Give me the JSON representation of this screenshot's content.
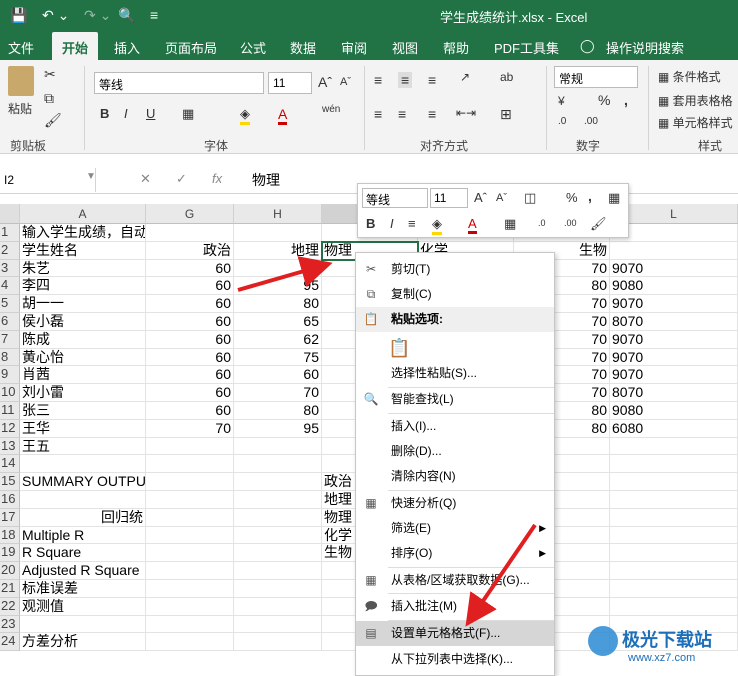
{
  "title": "学生成绩统计.xlsx - Excel",
  "tabs": [
    "文件",
    "开始",
    "插入",
    "页面布局",
    "公式",
    "数据",
    "审阅",
    "视图",
    "帮助",
    "PDF工具集",
    "操作说明搜索"
  ],
  "ribbon": {
    "paste": "粘贴",
    "font_name": "等线",
    "font_size": "11",
    "number_format": "常规",
    "cond_format": "条件格式",
    "table_format": "套用表格格",
    "cell_style": "单元格样式",
    "groups": [
      "剪贴板",
      "字体",
      "对齐方式",
      "数字",
      "样式"
    ]
  },
  "formula_bar": {
    "name_box": "I2",
    "value": "物理"
  },
  "columns": [
    "A",
    "G",
    "H",
    "I",
    "L"
  ],
  "rows": [
    {
      "n": "1",
      "A": "输入学生成绩，自动",
      "G": "",
      "H": "",
      "I": "",
      "J": "",
      "K": "",
      "L": ""
    },
    {
      "n": "2",
      "A": "学生姓名",
      "G": "政治",
      "H": "地理",
      "I": "物理",
      "J": "化学",
      "K": "生物",
      "L": ""
    },
    {
      "n": "3",
      "A": "朱艺",
      "G": "60",
      "H": "80",
      "I": "",
      "J": "",
      "K": "70",
      "L": "9070"
    },
    {
      "n": "4",
      "A": "李四",
      "G": "60",
      "H": "95",
      "I": "",
      "J": "",
      "K": "80",
      "L": "9080"
    },
    {
      "n": "5",
      "A": "胡一一",
      "G": "60",
      "H": "80",
      "I": "",
      "J": "",
      "K": "70",
      "L": "9070"
    },
    {
      "n": "6",
      "A": "侯小磊",
      "G": "60",
      "H": "65",
      "I": "",
      "J": "",
      "K": "70",
      "L": "8070"
    },
    {
      "n": "7",
      "A": "陈成",
      "G": "60",
      "H": "62",
      "I": "",
      "J": "",
      "K": "70",
      "L": "9070"
    },
    {
      "n": "8",
      "A": "黄心怡",
      "G": "60",
      "H": "75",
      "I": "",
      "J": "",
      "K": "70",
      "L": "9070"
    },
    {
      "n": "9",
      "A": "肖茜",
      "G": "60",
      "H": "60",
      "I": "",
      "J": "",
      "K": "70",
      "L": "9070"
    },
    {
      "n": "10",
      "A": "刘小雷",
      "G": "60",
      "H": "70",
      "I": "",
      "J": "",
      "K": "70",
      "L": "8070"
    },
    {
      "n": "11",
      "A": "张三",
      "G": "60",
      "H": "80",
      "I": "",
      "J": "",
      "K": "80",
      "L": "9080"
    },
    {
      "n": "12",
      "A": "王华",
      "G": "70",
      "H": "95",
      "I": "",
      "J": "",
      "K": "80",
      "L": "6080"
    },
    {
      "n": "13",
      "A": "王五",
      "G": "",
      "H": "",
      "I": "",
      "J": "",
      "K": "",
      "L": ""
    },
    {
      "n": "14",
      "A": "",
      "G": "",
      "H": "",
      "I": "",
      "J": "",
      "K": "",
      "L": ""
    },
    {
      "n": "15",
      "A": "SUMMARY OUTPUT",
      "G": "",
      "H": "",
      "I": "政治",
      "J": "",
      "K": "",
      "L": ""
    },
    {
      "n": "16",
      "A": "",
      "G": "",
      "H": "",
      "I": "地理",
      "J": "",
      "K": "",
      "L": ""
    },
    {
      "n": "17",
      "A": "回归统",
      "G": "",
      "H": "",
      "I": "物理",
      "J": "",
      "K": "",
      "L": ""
    },
    {
      "n": "18",
      "A": "Multiple R",
      "G": "",
      "H": "",
      "I": "化学",
      "J": "",
      "K": "",
      "L": ""
    },
    {
      "n": "19",
      "A": "R Square",
      "G": "",
      "H": "",
      "I": "生物",
      "J": "",
      "K": "",
      "L": ""
    },
    {
      "n": "20",
      "A": "Adjusted R Square",
      "G": "",
      "H": "",
      "I": "",
      "J": "",
      "K": "",
      "L": ""
    },
    {
      "n": "21",
      "A": "标准误差",
      "G": "",
      "H": "",
      "I": "",
      "J": "",
      "K": "",
      "L": ""
    },
    {
      "n": "22",
      "A": "观测值",
      "G": "",
      "H": "",
      "I": "",
      "J": "",
      "K": "",
      "L": ""
    },
    {
      "n": "23",
      "A": "",
      "G": "",
      "H": "",
      "I": "",
      "J": "",
      "K": "",
      "L": ""
    },
    {
      "n": "24",
      "A": "方差分析",
      "G": "",
      "H": "",
      "I": "",
      "J": "",
      "K": "",
      "L": ""
    }
  ],
  "mini_toolbar": {
    "font": "等线",
    "size": "11"
  },
  "context_menu": [
    {
      "label": "剪切(T)",
      "icon": "scissors-icon"
    },
    {
      "label": "复制(C)",
      "icon": "copy-icon"
    },
    {
      "label": "粘贴选项:",
      "icon": "paste-icon"
    },
    {
      "label": "",
      "icon": "paste-values-icon"
    },
    {
      "label": "选择性粘贴(S)...",
      "icon": ""
    },
    {
      "label": "智能查找(L)",
      "icon": "search-icon"
    },
    {
      "label": "插入(I)...",
      "icon": ""
    },
    {
      "label": "删除(D)...",
      "icon": ""
    },
    {
      "label": "清除内容(N)",
      "icon": ""
    },
    {
      "label": "快速分析(Q)",
      "icon": "quick-analysis-icon"
    },
    {
      "label": "筛选(E)",
      "icon": ""
    },
    {
      "label": "排序(O)",
      "icon": ""
    },
    {
      "label": "从表格/区域获取数据(G)...",
      "icon": "table-icon"
    },
    {
      "label": "插入批注(M)",
      "icon": "comment-icon"
    },
    {
      "label": "设置单元格格式(F)...",
      "icon": "format-cells-icon"
    },
    {
      "label": "从下拉列表中选择(K)...",
      "icon": ""
    }
  ],
  "watermark": "极光下载站",
  "watermark_url": "www.xz7.com"
}
